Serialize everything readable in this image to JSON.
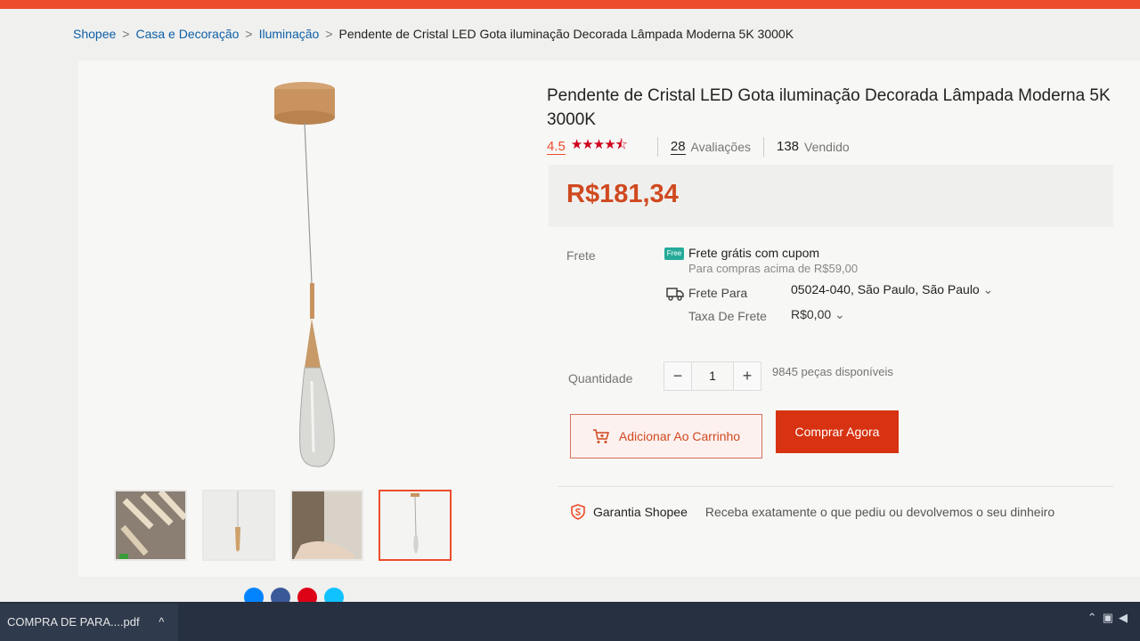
{
  "breadcrumb": {
    "items": [
      "Shopee",
      "Casa e Decoração",
      "Iluminação"
    ],
    "current": "Pendente de Cristal LED Gota iluminação Decorada Lâmpada Moderna 5K 3000K"
  },
  "product": {
    "title": "Pendente de Cristal LED Gota iluminação Decorada Lâmpada Moderna 5K 3000K",
    "rating_value": "4.5",
    "rating_stars": 4.5,
    "reviews_count": "28",
    "reviews_label": "Avaliações",
    "sold_count": "138",
    "sold_label": "Vendido",
    "price": "R$181,34"
  },
  "shipping": {
    "label": "Frete",
    "free_badge": "Free",
    "free_title": "Frete grátis com cupom",
    "free_subtitle": "Para compras acima de R$59,00",
    "to_label": "Frete Para",
    "to_value": "05024-040, São Paulo, São Paulo",
    "fee_label": "Taxa De Frete",
    "fee_value": "R$0,00"
  },
  "quantity": {
    "label": "Quantidade",
    "value": "1",
    "minus": "−",
    "plus": "+",
    "available": "9845 peças disponíveis"
  },
  "actions": {
    "add_to_cart": "Adicionar Ao Carrinho",
    "buy_now": "Comprar Agora"
  },
  "guarantee": {
    "title": "Garantia Shopee",
    "text": "Receba exatamente o que pediu ou devolvemos o seu dinheiro"
  },
  "taskbar": {
    "download_name": "COMPRA DE PARA....pdf",
    "chevron": "^"
  },
  "colors": {
    "brand": "#ee4d2d",
    "price": "#d0491f",
    "buy_button": "#d73211",
    "free_shipping": "#26aa99"
  },
  "icons": [
    "cart-icon",
    "truck-icon",
    "free-shipping-icon",
    "shield-icon",
    "chevron-down-icon",
    "star-icon"
  ]
}
